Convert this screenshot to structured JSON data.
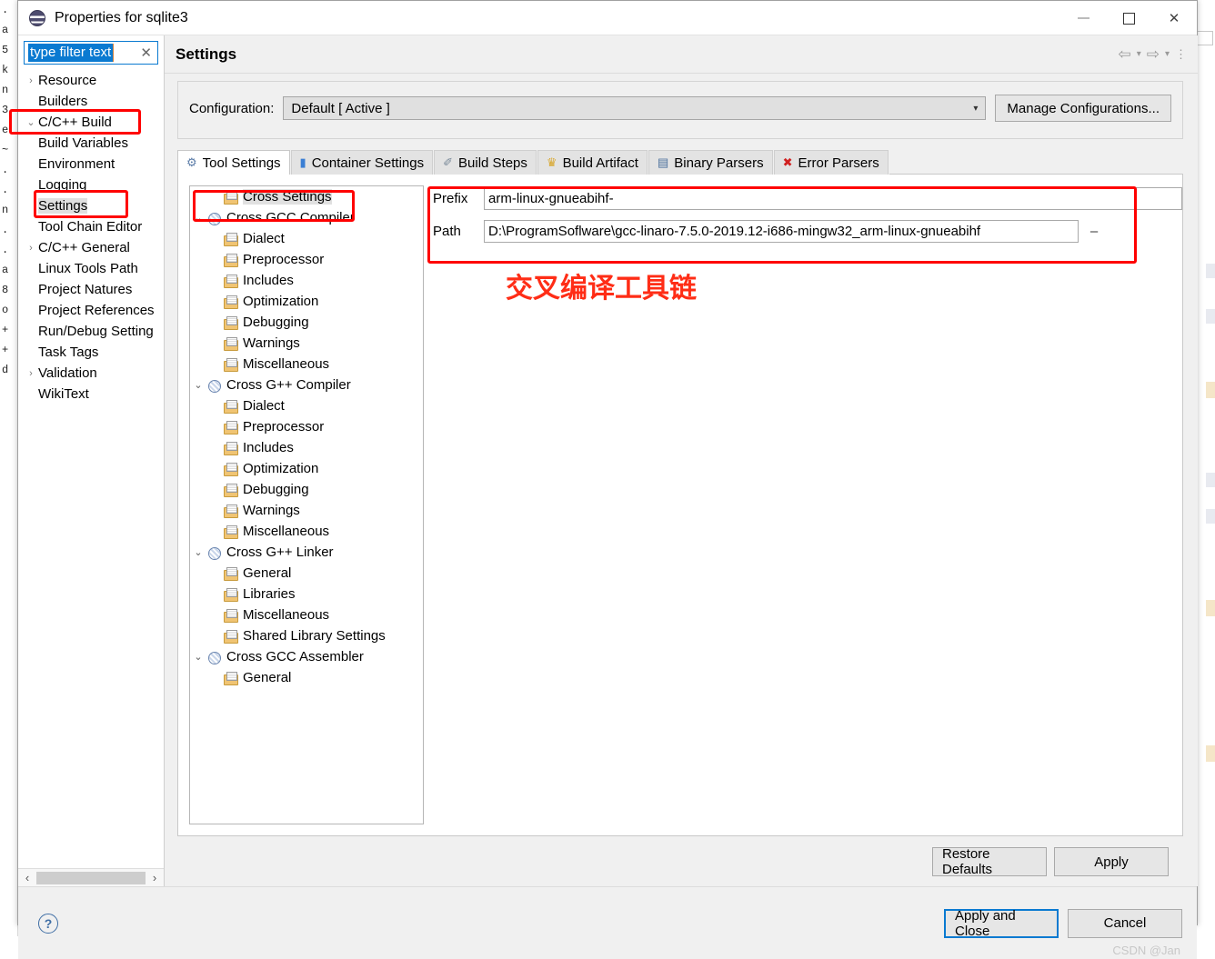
{
  "window": {
    "title": "Properties for sqlite3",
    "icon": "eclipse-logo-icon",
    "minimize_label": "–",
    "maximize_label": "",
    "close_label": "✕"
  },
  "sidebar": {
    "filter": {
      "value": "type filter text",
      "clear_label": "✕"
    },
    "items": [
      {
        "label": "Resource",
        "arrow": "›",
        "indent": 0,
        "selected": false
      },
      {
        "label": "Builders",
        "arrow": "",
        "indent": 0,
        "selected": false
      },
      {
        "label": "C/C++ Build",
        "arrow": "⌄",
        "indent": 0,
        "selected": false
      },
      {
        "label": "Build Variables",
        "arrow": "",
        "indent": 1,
        "selected": false
      },
      {
        "label": "Environment",
        "arrow": "",
        "indent": 1,
        "selected": false
      },
      {
        "label": "Logging",
        "arrow": "",
        "indent": 1,
        "selected": false
      },
      {
        "label": "Settings",
        "arrow": "",
        "indent": 1,
        "selected": true
      },
      {
        "label": "Tool Chain Editor",
        "arrow": "",
        "indent": 1,
        "selected": false
      },
      {
        "label": "C/C++ General",
        "arrow": "›",
        "indent": 0,
        "selected": false
      },
      {
        "label": "Linux Tools Path",
        "arrow": "",
        "indent": 0,
        "selected": false
      },
      {
        "label": "Project Natures",
        "arrow": "",
        "indent": 0,
        "selected": false
      },
      {
        "label": "Project References",
        "arrow": "",
        "indent": 0,
        "selected": false
      },
      {
        "label": "Run/Debug Setting",
        "arrow": "",
        "indent": 0,
        "selected": false
      },
      {
        "label": "Task Tags",
        "arrow": "",
        "indent": 0,
        "selected": false
      },
      {
        "label": "Validation",
        "arrow": "›",
        "indent": 0,
        "selected": false
      },
      {
        "label": "WikiText",
        "arrow": "",
        "indent": 0,
        "selected": false
      }
    ],
    "hscroll": {
      "left_label": "‹",
      "right_label": "›"
    }
  },
  "page": {
    "title": "Settings",
    "nav": {
      "back": "⇦",
      "back_menu": "▾",
      "forward": "⇨",
      "forward_menu": "▾",
      "view_menu": "⋮"
    }
  },
  "configuration": {
    "label": "Configuration:",
    "value": "Default  [ Active ]",
    "chevron": "▾",
    "manage_button": "Manage Configurations..."
  },
  "tabs": [
    {
      "label": "Tool Settings",
      "icon": "tool-settings-icon",
      "active": true
    },
    {
      "label": "Container Settings",
      "icon": "container-settings-icon",
      "active": false
    },
    {
      "label": "Build Steps",
      "icon": "build-steps-icon",
      "active": false
    },
    {
      "label": "Build Artifact",
      "icon": "build-artifact-icon",
      "active": false
    },
    {
      "label": "Binary Parsers",
      "icon": "binary-parsers-icon",
      "active": false
    },
    {
      "label": "Error Parsers",
      "icon": "error-parsers-icon",
      "active": false
    }
  ],
  "tool_tree": [
    {
      "label": "Cross Settings",
      "arrow": "",
      "indent": 1,
      "icon": "folder",
      "selected": true
    },
    {
      "label": "Cross GCC Compiler",
      "arrow": "⌄",
      "indent": 0,
      "icon": "tool",
      "selected": false
    },
    {
      "label": "Dialect",
      "arrow": "",
      "indent": 1,
      "icon": "folder",
      "selected": false
    },
    {
      "label": "Preprocessor",
      "arrow": "",
      "indent": 1,
      "icon": "folder",
      "selected": false
    },
    {
      "label": "Includes",
      "arrow": "",
      "indent": 1,
      "icon": "folder",
      "selected": false
    },
    {
      "label": "Optimization",
      "arrow": "",
      "indent": 1,
      "icon": "folder",
      "selected": false
    },
    {
      "label": "Debugging",
      "arrow": "",
      "indent": 1,
      "icon": "folder",
      "selected": false
    },
    {
      "label": "Warnings",
      "arrow": "",
      "indent": 1,
      "icon": "folder",
      "selected": false
    },
    {
      "label": "Miscellaneous",
      "arrow": "",
      "indent": 1,
      "icon": "folder",
      "selected": false
    },
    {
      "label": "Cross G++ Compiler",
      "arrow": "⌄",
      "indent": 0,
      "icon": "tool",
      "selected": false
    },
    {
      "label": "Dialect",
      "arrow": "",
      "indent": 1,
      "icon": "folder",
      "selected": false
    },
    {
      "label": "Preprocessor",
      "arrow": "",
      "indent": 1,
      "icon": "folder",
      "selected": false
    },
    {
      "label": "Includes",
      "arrow": "",
      "indent": 1,
      "icon": "folder",
      "selected": false
    },
    {
      "label": "Optimization",
      "arrow": "",
      "indent": 1,
      "icon": "folder",
      "selected": false
    },
    {
      "label": "Debugging",
      "arrow": "",
      "indent": 1,
      "icon": "folder",
      "selected": false
    },
    {
      "label": "Warnings",
      "arrow": "",
      "indent": 1,
      "icon": "folder",
      "selected": false
    },
    {
      "label": "Miscellaneous",
      "arrow": "",
      "indent": 1,
      "icon": "folder",
      "selected": false
    },
    {
      "label": "Cross G++ Linker",
      "arrow": "⌄",
      "indent": 0,
      "icon": "tool",
      "selected": false
    },
    {
      "label": "General",
      "arrow": "",
      "indent": 1,
      "icon": "folder",
      "selected": false
    },
    {
      "label": "Libraries",
      "arrow": "",
      "indent": 1,
      "icon": "folder",
      "selected": false
    },
    {
      "label": "Miscellaneous",
      "arrow": "",
      "indent": 1,
      "icon": "folder",
      "selected": false
    },
    {
      "label": "Shared Library Settings",
      "arrow": "",
      "indent": 1,
      "icon": "folder",
      "selected": false
    },
    {
      "label": "Cross GCC Assembler",
      "arrow": "⌄",
      "indent": 0,
      "icon": "tool",
      "selected": false
    },
    {
      "label": "General",
      "arrow": "",
      "indent": 1,
      "icon": "folder",
      "selected": false
    }
  ],
  "cross_settings": {
    "prefix_label": "Prefix",
    "prefix_value": "arm-linux-gnueabihf-",
    "path_label": "Path",
    "path_value": "D:\\ProgramSoflware\\gcc-linaro-7.5.0-2019.12-i686-mingw32_arm-linux-gnueabihf",
    "browse_label": "–",
    "annotation": "交叉编译工具链",
    "annotation_color": "#ff2d16"
  },
  "buttons": {
    "restore_defaults": "Restore Defaults",
    "apply": "Apply",
    "apply_and_close": "Apply and Close",
    "cancel": "Cancel",
    "help": "?"
  },
  "watermark": "CSDN @Jan",
  "background_left_chars": [
    ".",
    "a",
    "5",
    "k",
    "n",
    "3",
    "e",
    "~",
    ".",
    ".",
    "n",
    ".",
    "",
    "",
    ".",
    "a",
    "8",
    "o",
    "+",
    "+",
    "d"
  ]
}
